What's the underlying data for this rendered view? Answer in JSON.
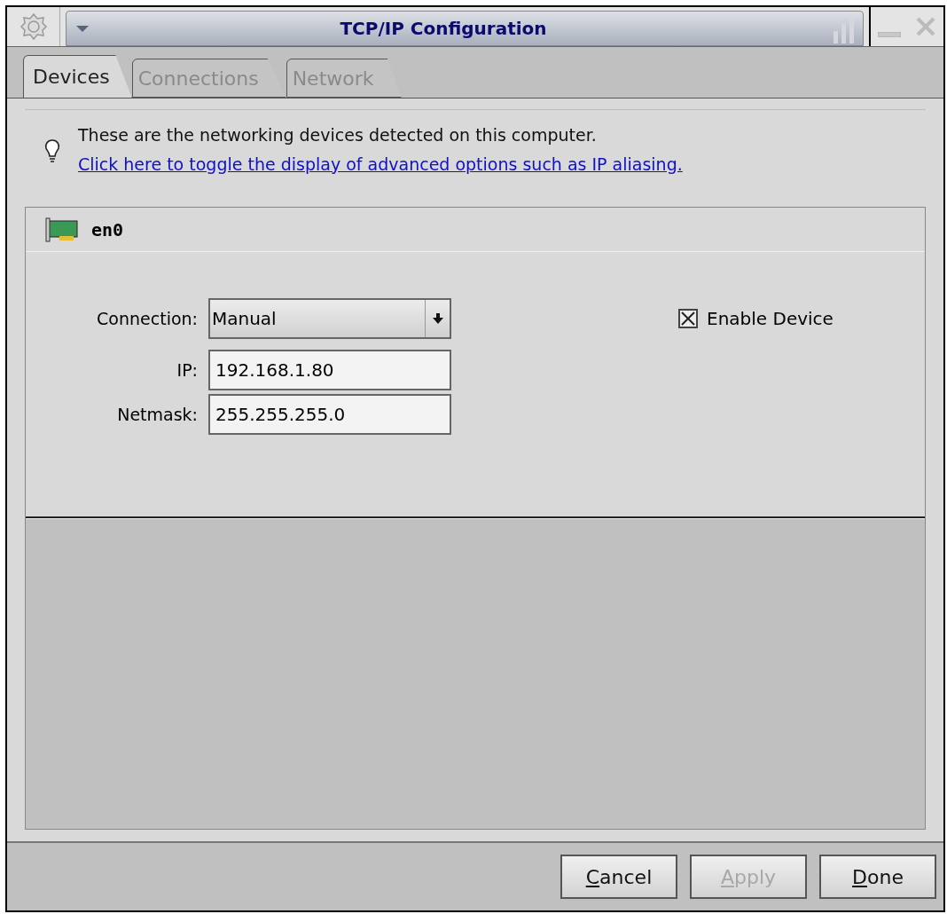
{
  "window": {
    "title": "TCP/IP Configuration"
  },
  "tabs": [
    {
      "label": "Devices",
      "selected": true
    },
    {
      "label": "Connections",
      "selected": false
    },
    {
      "label": "Network",
      "selected": false
    }
  ],
  "info": {
    "text": "These are the networking devices detected on this computer.",
    "link": "Click here to toggle the display of advanced options such as IP aliasing."
  },
  "device": {
    "name": "en0",
    "connection_label": "Connection:",
    "connection_value": "Manual",
    "ip_label": "IP:",
    "ip_value": "192.168.1.80",
    "netmask_label": "Netmask:",
    "netmask_value": "255.255.255.0",
    "enable_label": "Enable Device",
    "enabled": true
  },
  "buttons": [
    {
      "label": "Cancel",
      "disabled": false
    },
    {
      "label": "Apply",
      "disabled": true
    },
    {
      "label": "Done",
      "disabled": false
    }
  ]
}
